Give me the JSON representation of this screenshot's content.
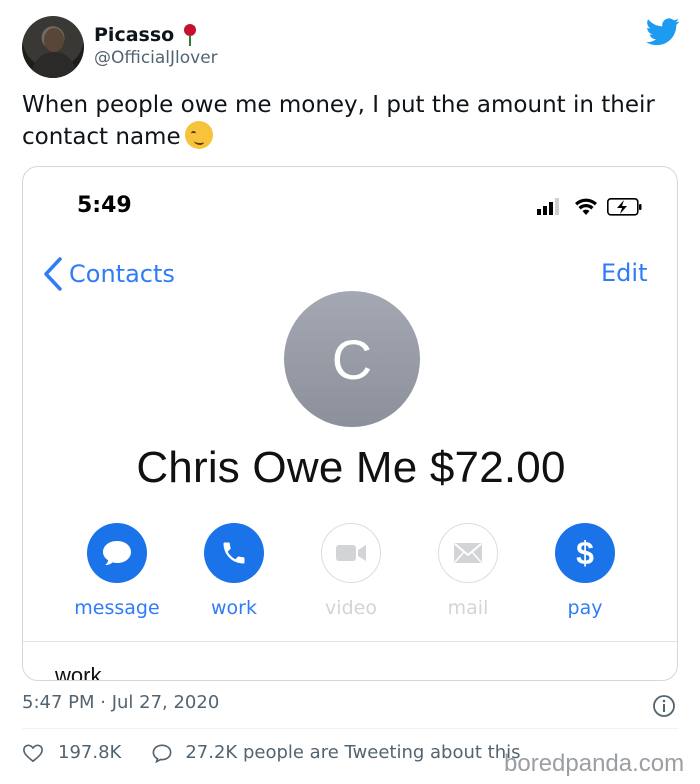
{
  "author": {
    "name": "Picasso",
    "handle": "@OfficialJlover"
  },
  "tweet": {
    "text": "When people owe me money, I put the amount in their contact name"
  },
  "phone": {
    "status_time": "5:49",
    "back_label": "Contacts",
    "edit_label": "Edit",
    "avatar_initial": "C",
    "contact_name": "Chris Owe Me $72.00",
    "actions": [
      {
        "label": "message",
        "state": "active"
      },
      {
        "label": "work",
        "state": "active"
      },
      {
        "label": "video",
        "state": "disabled"
      },
      {
        "label": "mail",
        "state": "disabled"
      },
      {
        "label": "pay",
        "state": "active"
      }
    ],
    "field_peek": "work"
  },
  "footer": {
    "timestamp": "5:47 PM · Jul 27, 2020",
    "likes": "197.8K",
    "tweeting": "27.2K people are Tweeting about this"
  },
  "watermark": "boredpanda.com",
  "colors": {
    "ios_blue": "#1a73e8",
    "link_blue": "#2f7cf6",
    "twitter_blue": "#1d9bf0",
    "muted": "#536471"
  },
  "icons": [
    "twitter-bird-icon",
    "rose-icon",
    "woozy-face-icon",
    "chevron-left-icon",
    "signal-icon",
    "wifi-icon",
    "battery-charging-icon",
    "message-icon",
    "phone-icon",
    "video-icon",
    "mail-icon",
    "dollar-icon",
    "info-icon",
    "heart-icon",
    "reply-bubble-icon"
  ]
}
